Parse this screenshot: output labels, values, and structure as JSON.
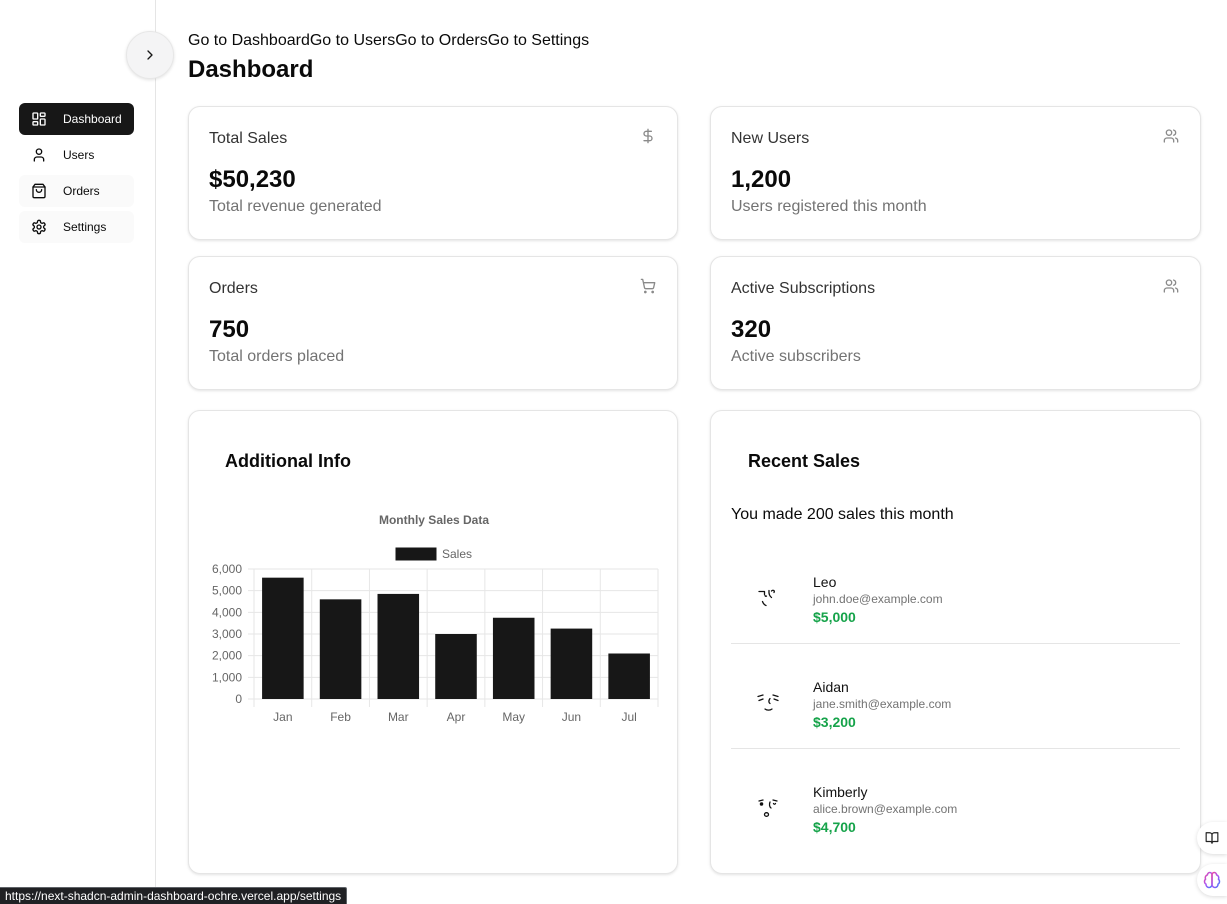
{
  "sidebar": {
    "toggle_icon": "chevron-right-icon",
    "items": [
      {
        "label": "Dashboard",
        "icon": "layout-dashboard-icon",
        "active": true
      },
      {
        "label": "Users",
        "icon": "user-icon",
        "active": false
      },
      {
        "label": "Orders",
        "icon": "shopping-bag-icon",
        "active": false
      },
      {
        "label": "Settings",
        "icon": "gear-icon",
        "active": false
      }
    ]
  },
  "header": {
    "links": [
      "Go to Dashboard",
      "Go to Users",
      "Go to Orders",
      "Go to Settings"
    ],
    "title": "Dashboard"
  },
  "stats": [
    {
      "title": "Total Sales",
      "icon": "dollar-sign-icon",
      "value": "$50,230",
      "description": "Total revenue generated"
    },
    {
      "title": "New Users",
      "icon": "users-icon",
      "value": "1,200",
      "description": "Users registered this month"
    },
    {
      "title": "Orders",
      "icon": "shopping-cart-icon",
      "value": "750",
      "description": "Total orders placed"
    },
    {
      "title": "Active Subscriptions",
      "icon": "users-icon",
      "value": "320",
      "description": "Active subscribers"
    }
  ],
  "additional_info": {
    "title": "Additional Info"
  },
  "chart_data": {
    "type": "bar",
    "title": "Monthly Sales Data",
    "categories": [
      "Jan",
      "Feb",
      "Mar",
      "Apr",
      "May",
      "Jun",
      "Jul"
    ],
    "series": [
      {
        "name": "Sales",
        "values": [
          5600,
          4600,
          4850,
          3000,
          3750,
          3250,
          2100
        ]
      }
    ],
    "ylim": [
      0,
      6000
    ],
    "ytick_labels": [
      "0",
      "1,000",
      "2,000",
      "3,000",
      "4,000",
      "5,000",
      "6,000"
    ],
    "grid": true,
    "legend": "top",
    "color": "#171717"
  },
  "recent_sales": {
    "title": "Recent Sales",
    "summary": "You made 200 sales this month",
    "items": [
      {
        "name": "Leo",
        "email": "john.doe@example.com",
        "amount": "$5,000",
        "avatar": "doodle-face-avatar"
      },
      {
        "name": "Aidan",
        "email": "jane.smith@example.com",
        "amount": "$3,200",
        "avatar": "doodle-face-avatar"
      },
      {
        "name": "Kimberly",
        "email": "alice.brown@example.com",
        "amount": "$4,700",
        "avatar": "doodle-face-avatar"
      }
    ]
  },
  "floating_buttons": [
    {
      "icon": "book-open-icon"
    },
    {
      "icon": "brain-icon"
    }
  ],
  "status_bar": {
    "url": "https://next-shadcn-admin-dashboard-ochre.vercel.app/settings"
  },
  "colors": {
    "primary": "#171717",
    "amount_green": "#16a34a",
    "muted_text": "#737373",
    "border": "#e5e5e5"
  }
}
